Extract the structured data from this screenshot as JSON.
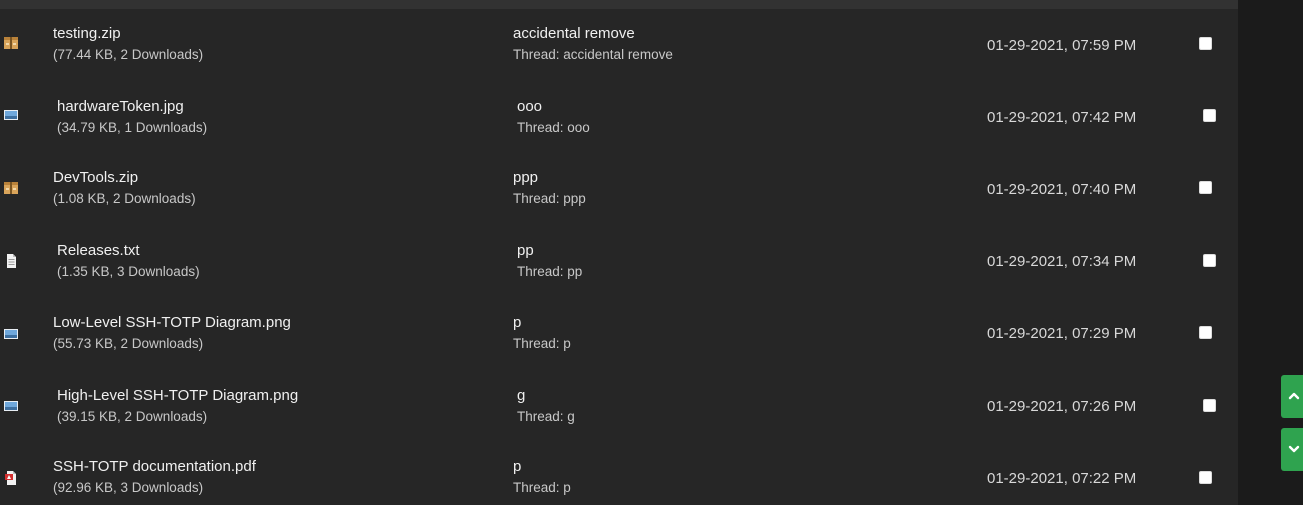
{
  "attachments": [
    {
      "file_name": "testing.zip",
      "file_info": "(77.44 KB, 2 Downloads)",
      "subject": "accidental remove",
      "thread": "Thread: accidental remove",
      "date": "01-29-2021, 07:59 PM",
      "icon": "zip-archive-icon",
      "checked": false
    },
    {
      "file_name": "hardwareToken.jpg",
      "file_info": "(34.79 KB, 1 Downloads)",
      "subject": "ooo",
      "thread": "Thread: ooo",
      "date": "01-29-2021, 07:42 PM",
      "icon": "image-file-icon",
      "checked": false
    },
    {
      "file_name": "DevTools.zip",
      "file_info": "(1.08 KB, 2 Downloads)",
      "subject": "ppp",
      "thread": "Thread: ppp",
      "date": "01-29-2021, 07:40 PM",
      "icon": "zip-archive-icon",
      "checked": false
    },
    {
      "file_name": "Releases.txt",
      "file_info": "(1.35 KB, 3 Downloads)",
      "subject": "pp",
      "thread": "Thread: pp",
      "date": "01-29-2021, 07:34 PM",
      "icon": "text-file-icon",
      "checked": false
    },
    {
      "file_name": "Low-Level SSH-TOTP Diagram.png",
      "file_info": "(55.73 KB, 2 Downloads)",
      "subject": "p",
      "thread": "Thread: p",
      "date": "01-29-2021, 07:29 PM",
      "icon": "image-file-icon",
      "checked": false
    },
    {
      "file_name": "High-Level SSH-TOTP Diagram.png",
      "file_info": "(39.15 KB, 2 Downloads)",
      "subject": "g",
      "thread": "Thread: g",
      "date": "01-29-2021, 07:26 PM",
      "icon": "image-file-icon",
      "checked": false
    },
    {
      "file_name": "SSH-TOTP documentation.pdf",
      "file_info": "(92.96 KB, 3 Downloads)",
      "subject": "p",
      "thread": "Thread: p",
      "date": "01-29-2021, 07:22 PM",
      "icon": "pdf-file-icon",
      "checked": false
    }
  ],
  "scroll_controls": {
    "up_icon": "chevron-up-icon",
    "down_icon": "chevron-down-icon",
    "color": "#2fa34f"
  }
}
